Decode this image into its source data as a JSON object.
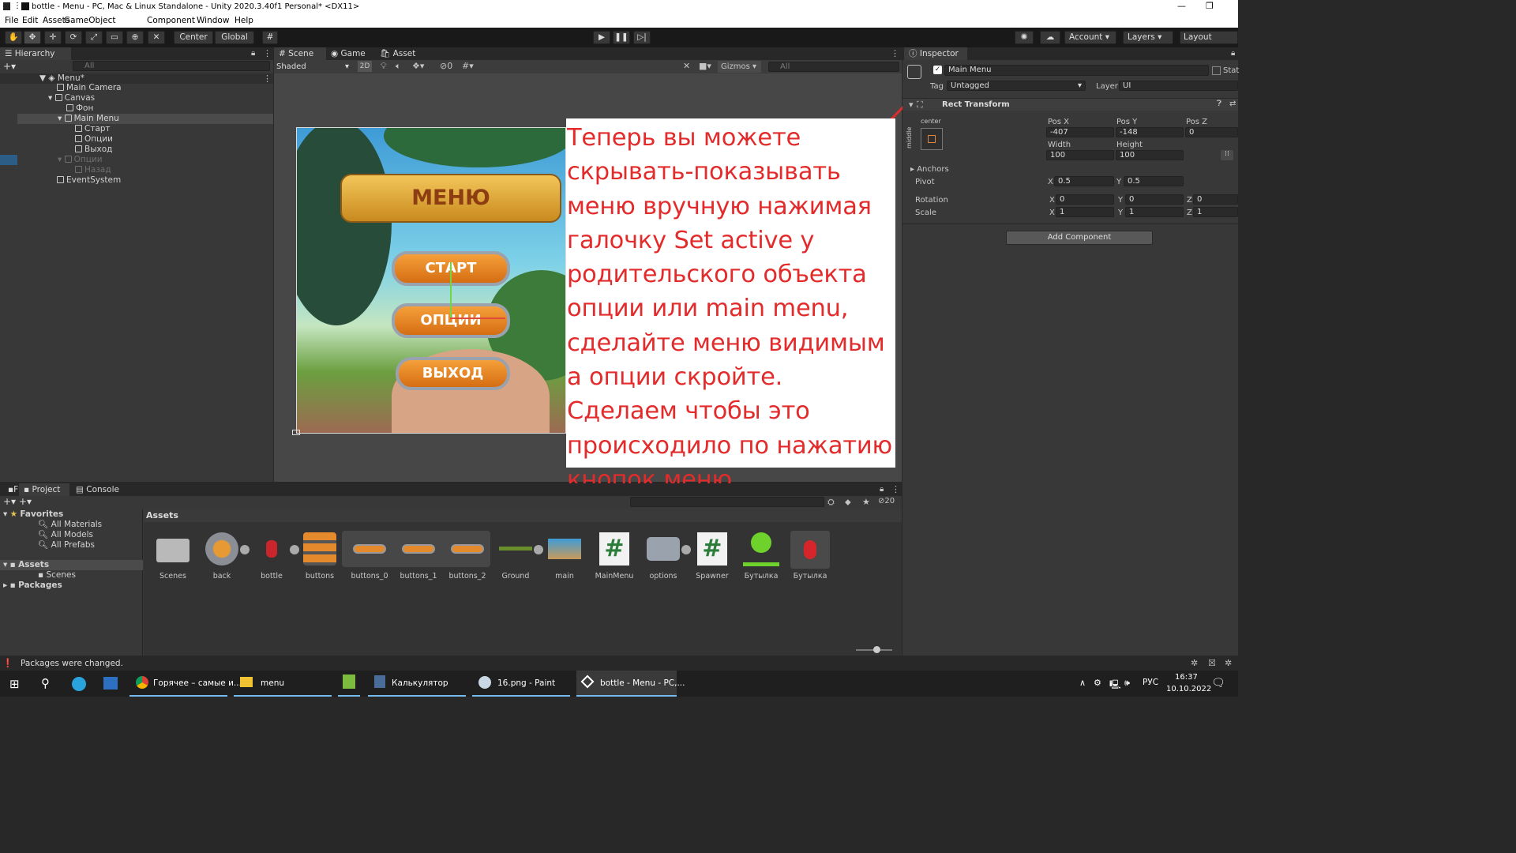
{
  "window": {
    "title": "bottle - Menu - PC, Mac & Linux Standalone - Unity 2020.3.40f1 Personal* <DX11>"
  },
  "menubar": [
    "File",
    "Edit",
    "Assets",
    "GameObject",
    "Component",
    "Window",
    "Help"
  ],
  "toolbar": {
    "pivot": "Center",
    "space": "Global",
    "account": "Account",
    "layers": "Layers",
    "layout": "Layout"
  },
  "hierarchy": {
    "tab": "Hierarchy",
    "search_placeholder": "All",
    "items": [
      {
        "label": "Menu*"
      },
      {
        "label": "Main Camera"
      },
      {
        "label": "Canvas"
      },
      {
        "label": "Фон"
      },
      {
        "label": "Main Menu"
      },
      {
        "label": "Старт"
      },
      {
        "label": "Опции"
      },
      {
        "label": "Выход"
      },
      {
        "label": "Опции"
      },
      {
        "label": "Назад"
      },
      {
        "label": "EventSystem"
      }
    ]
  },
  "scene": {
    "tabs": [
      "Scene",
      "Game",
      "Asset Store"
    ],
    "shading": "Shaded",
    "mode2d": "2D",
    "hidden_count": "0",
    "gizmos": "Gizmos",
    "search_placeholder": "All",
    "game_buttons": {
      "title": "МЕНЮ",
      "start": "СТАРТ",
      "options": "ОПЦИИ",
      "exit": "ВЫХОД"
    }
  },
  "overlay_text": "Теперь вы можете скрывать-показывать меню вручную нажимая галочку Set active у родительского объекта опции или main menu, сделайте меню видимым а опции скройте. Сделаем чтобы это происходило по нажатию кнопок меню",
  "inspector": {
    "tab": "Inspector",
    "object_name": "Main Menu",
    "static_label": "Stat",
    "tag_label": "Tag",
    "tag_value": "Untagged",
    "layer_label": "Layer",
    "layer_value": "UI",
    "component": "Rect Transform",
    "anchor_h": "center",
    "anchor_v": "middle",
    "pos_x_label": "Pos X",
    "pos_x": "-407",
    "pos_y_label": "Pos Y",
    "pos_y": "-148",
    "pos_z_label": "Pos Z",
    "pos_z": "0",
    "width_label": "Width",
    "width": "100",
    "height_label": "Height",
    "height": "100",
    "anchors_label": "Anchors",
    "pivot_label": "Pivot",
    "pivot_x": "0.5",
    "pivot_y": "0.5",
    "rotation_label": "Rotation",
    "rot_x": "0",
    "rot_y": "0",
    "rot_z": "0",
    "scale_label": "Scale",
    "scale_x": "1",
    "scale_y": "1",
    "scale_z": "1",
    "axis_x": "X",
    "axis_y": "Y",
    "axis_z": "Z",
    "add_component": "Add Component"
  },
  "project": {
    "tabs": [
      "Project",
      "Console"
    ],
    "hidden_count": "20",
    "breadcrumb": "Assets",
    "tree": [
      {
        "label": "Favorites"
      },
      {
        "label": "All Materials"
      },
      {
        "label": "All Models"
      },
      {
        "label": "All Prefabs"
      },
      {
        "label": "Assets"
      },
      {
        "label": "Scenes"
      },
      {
        "label": "Packages"
      }
    ],
    "assets": [
      "Scenes",
      "back",
      "bottle",
      "buttons",
      "buttons_0",
      "buttons_1",
      "buttons_2",
      "Ground",
      "main",
      "MainMenu",
      "options",
      "Spawner",
      "Бутылка",
      "Бутылка"
    ]
  },
  "statusbar": {
    "message": "Packages were changed."
  },
  "taskbar": {
    "items": [
      "Горячее – самые и...",
      "menu",
      "",
      "Калькулятор",
      "16.png - Paint",
      "bottle - Menu - PC,..."
    ],
    "lang": "РУС",
    "time": "16:37",
    "date": "10.10.2022"
  },
  "colors": {
    "accent_red": "#e32b2b",
    "selection": "#2c5d87",
    "panel": "#383838"
  }
}
